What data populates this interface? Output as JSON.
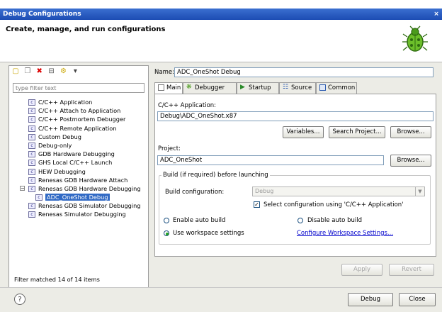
{
  "window": {
    "title": "Debug Configurations",
    "close_glyph": "×"
  },
  "header": {
    "title": "Create, manage, and run configurations",
    "icon": "bug-icon"
  },
  "left": {
    "toolbar_icons": [
      "new-launch-config-icon",
      "duplicate-icon",
      "delete-icon",
      "collapse-all-icon",
      "filter-icon",
      "view-menu-icon"
    ],
    "filter_placeholder": "type filter text",
    "tree": [
      {
        "label": "C/C++ Application",
        "level": 0
      },
      {
        "label": "C/C++ Attach to Application",
        "level": 0
      },
      {
        "label": "C/C++ Postmortem Debugger",
        "level": 0
      },
      {
        "label": "C/C++ Remote Application",
        "level": 0
      },
      {
        "label": "Custom Debug",
        "level": 0
      },
      {
        "label": "Debug-only",
        "level": 0
      },
      {
        "label": "GDB Hardware Debugging",
        "level": 0
      },
      {
        "label": "GHS Local C/C++ Launch",
        "level": 0
      },
      {
        "label": "HEW Debugging",
        "level": 0
      },
      {
        "label": "Renesas GDB Hardware Attach",
        "level": 0
      },
      {
        "label": "Renesas GDB Hardware Debugging",
        "level": 0,
        "expanded": true
      },
      {
        "label": "ADC_OneShot Debug",
        "level": 1,
        "selected": true
      },
      {
        "label": "Renesas GDB Simulator Debugging",
        "level": 0
      },
      {
        "label": "Renesas Simulator Debugging",
        "level": 0
      }
    ],
    "filter_status": "Filter matched 14 of 14 items"
  },
  "right": {
    "name_label": "Name:",
    "name_value": "ADC_OneShot Debug",
    "tabs": [
      {
        "label": "Main",
        "icon": "main-tab-icon",
        "active": true
      },
      {
        "label": "Debugger",
        "icon": "debugger-tab-icon"
      },
      {
        "label": "Startup",
        "icon": "startup-tab-icon"
      },
      {
        "label": "Source",
        "icon": "source-tab-icon"
      },
      {
        "label": "Common",
        "icon": "common-tab-icon"
      }
    ],
    "main": {
      "app_label": "C/C++ Application:",
      "app_value": "Debug\\ADC_OneShot.x87",
      "variables_btn": "Variables...",
      "search_project_btn": "Search Project...",
      "browse_btn": "Browse...",
      "project_label": "Project:",
      "project_value": "ADC_OneShot",
      "project_browse_btn": "Browse...",
      "build_group_title": "Build (if required) before launching",
      "build_config_label": "Build configuration:",
      "build_config_value": "Debug",
      "select_config_label": "Select configuration using 'C/C++ Application'",
      "select_config_checked": true,
      "enable_auto_build": "Enable auto build",
      "disable_auto_build": "Disable auto build",
      "use_workspace": "Use workspace settings",
      "configure_workspace": "Configure Workspace Settings...",
      "selected_build_option": "Use workspace settings"
    },
    "apply_btn": "Apply",
    "revert_btn": "Revert"
  },
  "footer": {
    "help_glyph": "?",
    "debug_btn": "Debug",
    "close_btn": "Close"
  }
}
